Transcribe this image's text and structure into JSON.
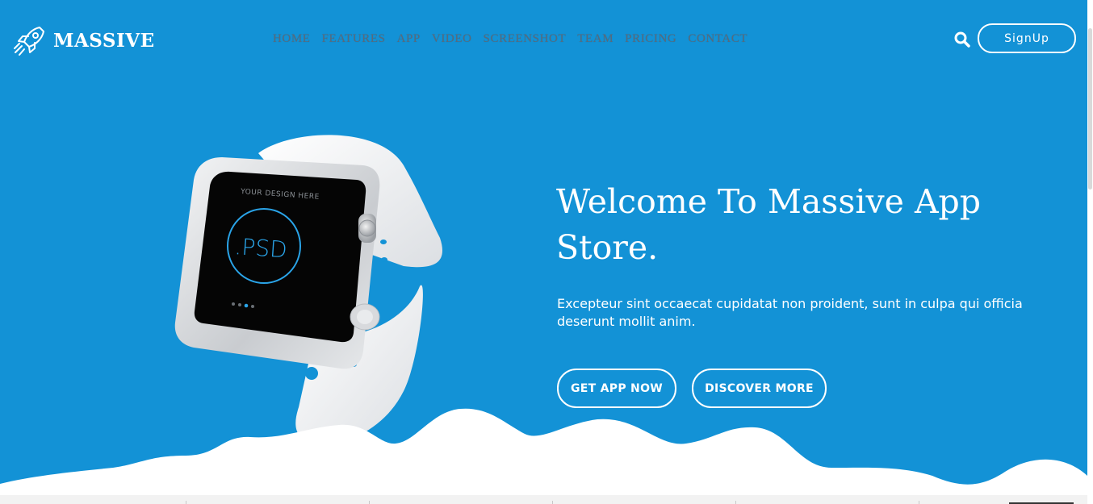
{
  "brand": {
    "name": "MASSIVE",
    "icon": "rocket-icon"
  },
  "nav": {
    "items": [
      "HOME",
      "FEATURES",
      "APP",
      "VIDEO",
      "SCREENSHOT",
      "TEAM",
      "PRICING",
      "CONTACT"
    ]
  },
  "header": {
    "search_icon": "search-icon",
    "signup_label": "SignUp"
  },
  "hero": {
    "title": "Welcome To Massive App Store.",
    "description": "Excepteur sint occaecat cupidatat non proident, sunt in culpa qui officia deserunt mollit anim.",
    "primary_button": "GET APP NOW",
    "secondary_button": "DISCOVER MORE"
  },
  "watch_screen": {
    "caption": "YOUR DESIGN HERE",
    "label": ".PSD"
  },
  "colors": {
    "hero_bg": "#1392d6",
    "text": "#ffffff",
    "nav_text": "#5a6a7a"
  }
}
